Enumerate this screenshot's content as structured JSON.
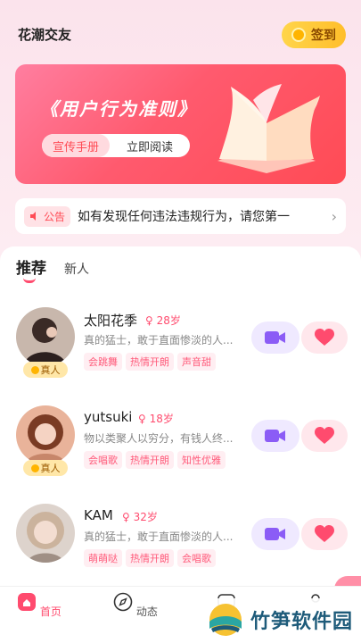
{
  "app": {
    "title": "花潮交友",
    "signin_label": "签到"
  },
  "banner": {
    "title": "《用户行为准则》",
    "pill_left": "宣传手册",
    "pill_right": "立即阅读"
  },
  "notice": {
    "tag": "公告",
    "text": "如有发现任何违法违规行为，请您第一"
  },
  "tabs": {
    "active": "推荐",
    "other": "新人"
  },
  "users": [
    {
      "name": "太阳花季",
      "age": "28岁",
      "bio": "真的猛士，敢于直面惨淡的人...",
      "verified": "真人",
      "tags": [
        "会跳舞",
        "热情开朗",
        "声音甜"
      ]
    },
    {
      "name": "yutsuki",
      "age": "18岁",
      "bio": "物以类聚人以穷分，有钱人终...",
      "verified": "真人",
      "tags": [
        "会唱歌",
        "热情开朗",
        "知性优雅"
      ]
    },
    {
      "name": "KAM",
      "age": "32岁",
      "bio": "真的猛士，敢于直面惨淡的人...",
      "verified": "",
      "tags": [
        "萌萌哒",
        "热情开朗",
        "会唱歌"
      ]
    }
  ],
  "nav": {
    "home": "首页",
    "moments": "动态"
  },
  "watermark": {
    "text": "竹笋软件园"
  },
  "colors": {
    "accent": "#ff4b6e",
    "banner": "#ff5a6e",
    "gold": "#ffbe2a"
  }
}
